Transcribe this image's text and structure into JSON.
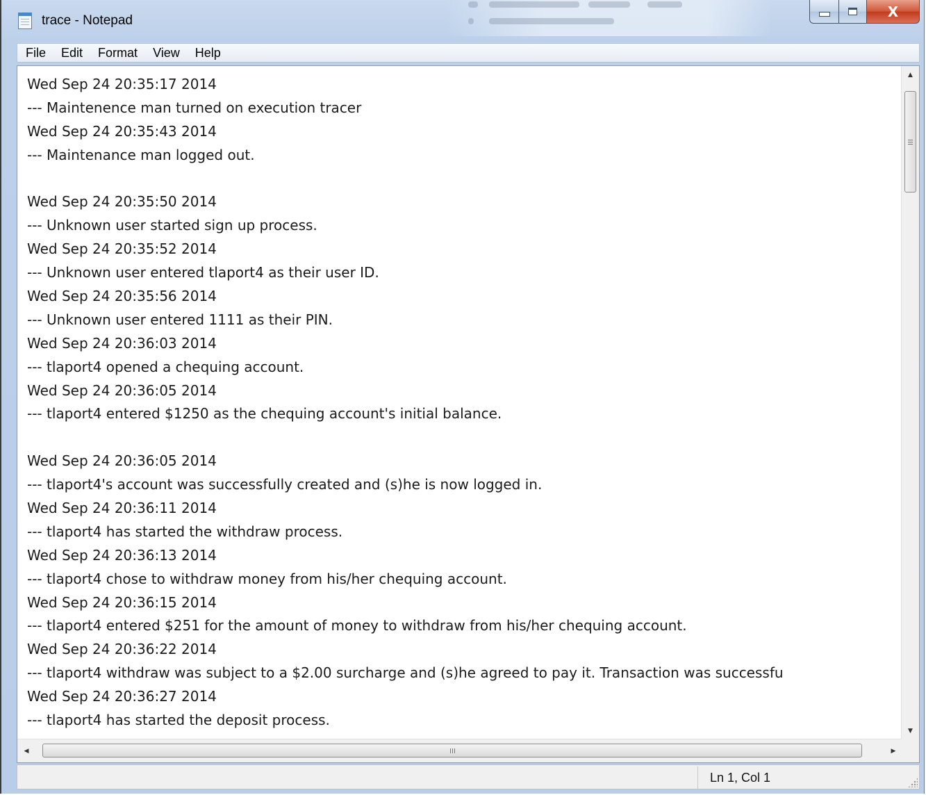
{
  "window": {
    "title": "trace - Notepad",
    "icon": "notepad-icon",
    "controls": {
      "minimize": "minimize-icon",
      "maximize": "maximize-icon",
      "close_label": "X"
    }
  },
  "menu": {
    "items": [
      {
        "label": "File"
      },
      {
        "label": "Edit"
      },
      {
        "label": "Format"
      },
      {
        "label": "View"
      },
      {
        "label": "Help"
      }
    ]
  },
  "document": {
    "lines": [
      "Wed Sep 24 20:35:17 2014",
      "--- Maintenence man turned on execution tracer",
      "Wed Sep 24 20:35:43 2014",
      "--- Maintenance man logged out.",
      "",
      "Wed Sep 24 20:35:50 2014",
      "--- Unknown user started sign up process.",
      "Wed Sep 24 20:35:52 2014",
      "--- Unknown user entered tlaport4 as their user ID.",
      "Wed Sep 24 20:35:56 2014",
      "--- Unknown user entered 1111 as their PIN.",
      "Wed Sep 24 20:36:03 2014",
      "--- tlaport4 opened a chequing account.",
      "Wed Sep 24 20:36:05 2014",
      "--- tlaport4 entered $1250 as the chequing account's initial balance.",
      "",
      "Wed Sep 24 20:36:05 2014",
      "--- tlaport4's account was successfully created and (s)he is now logged in.",
      "Wed Sep 24 20:36:11 2014",
      "--- tlaport4 has started the withdraw process.",
      "Wed Sep 24 20:36:13 2014",
      "--- tlaport4 chose to withdraw money from his/her chequing account.",
      "Wed Sep 24 20:36:15 2014",
      "--- tlaport4 entered $251 for the amount of money to withdraw from his/her chequing account.",
      "Wed Sep 24 20:36:22 2014",
      "--- tlaport4 withdraw was subject to a $2.00 surcharge and (s)he agreed to pay it. Transaction was successfu",
      "Wed Sep 24 20:36:27 2014",
      "--- tlaport4 has started the deposit process."
    ]
  },
  "scrollbars": {
    "up_arrow": "▲",
    "down_arrow": "▼",
    "left_arrow": "◀",
    "right_arrow": "▶",
    "vertical_position": 0,
    "horizontal_position": 0
  },
  "status": {
    "position": "Ln 1, Col 1"
  }
}
